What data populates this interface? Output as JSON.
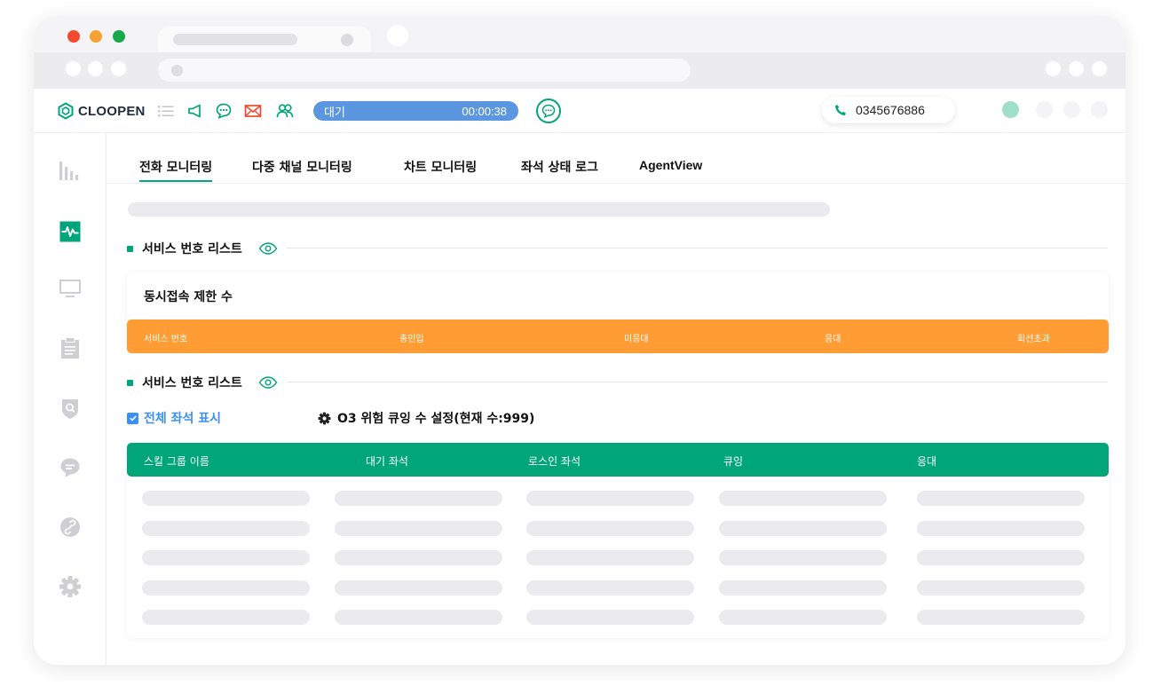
{
  "app": {
    "logo_text": "CLOOPEN"
  },
  "header": {
    "status_label": "대기",
    "status_timer": "00:00:38",
    "phone_number": "0345676886",
    "colors": {
      "accent": "#00a57a",
      "status_bar": "#5b97e0",
      "warning": "#ff9c33"
    },
    "icons": [
      "list-icon",
      "megaphone-icon",
      "chat-icon",
      "mail-icon",
      "users-icon"
    ]
  },
  "sidebar": {
    "items": [
      {
        "icon": "bar-chart-icon",
        "active": false
      },
      {
        "icon": "monitoring-pulse-icon",
        "active": true
      },
      {
        "icon": "monitor-icon",
        "active": false
      },
      {
        "icon": "clipboard-icon",
        "active": false
      },
      {
        "icon": "shield-search-icon",
        "active": false
      },
      {
        "icon": "message-icon",
        "active": false
      },
      {
        "icon": "link-icon",
        "active": false
      },
      {
        "icon": "gear-icon",
        "active": false
      }
    ]
  },
  "tabs": [
    {
      "label": "전화 모니터링",
      "active": true
    },
    {
      "label": "다중 채널 모니터링",
      "active": false
    },
    {
      "label": "차트 모니터링",
      "active": false
    },
    {
      "label": "좌석 상태 로그",
      "active": false
    },
    {
      "label": "AgentView",
      "active": false
    }
  ],
  "section1": {
    "title": "서비스 번호 리스트",
    "card_title": "동시접속 제한 수",
    "columns": [
      "서비스 번호",
      "총인입",
      "미응대",
      "응대",
      "회선초과"
    ]
  },
  "section2": {
    "title": "서비스 번호 리스트",
    "show_all_label": "전체 좌석 표시",
    "show_all_checked": true,
    "setting_label": "O3 위험 큐잉 수 설정(현재 수:999)",
    "columns": [
      "스킬 그룹 이름",
      "대기 좌석",
      "로스인 좌석",
      "큐잉",
      "응대"
    ]
  }
}
